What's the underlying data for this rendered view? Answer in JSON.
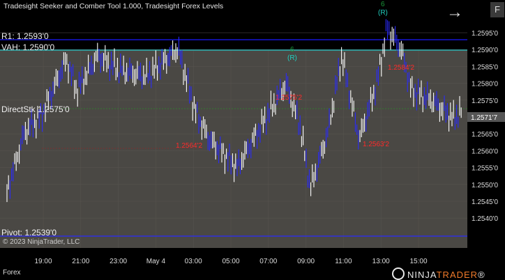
{
  "title": "Tradesight Seeker and Comber Tool 1.000, Tradesight Forex Levels",
  "panel_flag": "F",
  "levels": {
    "r1": "R1: 1.2593'0",
    "vah": "VAH: 1.2590'0",
    "overlap": "DirectStk 1.2575'0",
    "pivot": "Pivot: 1.2539'0"
  },
  "price_axis": [
    "1.2595'0",
    "1.2590'0",
    "1.2585'0",
    "1.2580'0",
    "1.2575'0",
    "1.2570'0",
    "1.2565'0",
    "1.2560'0",
    "1.2555'0",
    "1.2550'0",
    "1.2545'0",
    "1.2540'0"
  ],
  "last_price": "1.2571'7",
  "time_axis": [
    "19:00",
    "21:00",
    "23:00",
    "May 4",
    "03:00",
    "05:00",
    "07:00",
    "09:00",
    "11:00",
    "13:00",
    "15:00"
  ],
  "annotations": {
    "red": [
      "1.2564'2",
      "1.2575'2",
      "1.2563'2",
      "1.2584'2"
    ],
    "green": [
      "6",
      "(R)",
      "6",
      "(R)"
    ]
  },
  "copyright": "© 2023 NinjaTrader, LLC",
  "bottom_label": "Forex",
  "logo": {
    "ninja": "NINJA",
    "trader": "TRADER",
    "suffix": "®"
  },
  "colors": {
    "background": "#000000",
    "plot": "#4a4844",
    "up_candle": "#ffffff",
    "down_candle": "#2a2aff",
    "r1_line": "#1a1aff",
    "vah_line": "#20c0c0",
    "pivot_line": "#2a2aff",
    "red_text": "#ff2a2a",
    "green_text": "#1a9a3a",
    "cyan_text": "#20d0c0"
  }
}
